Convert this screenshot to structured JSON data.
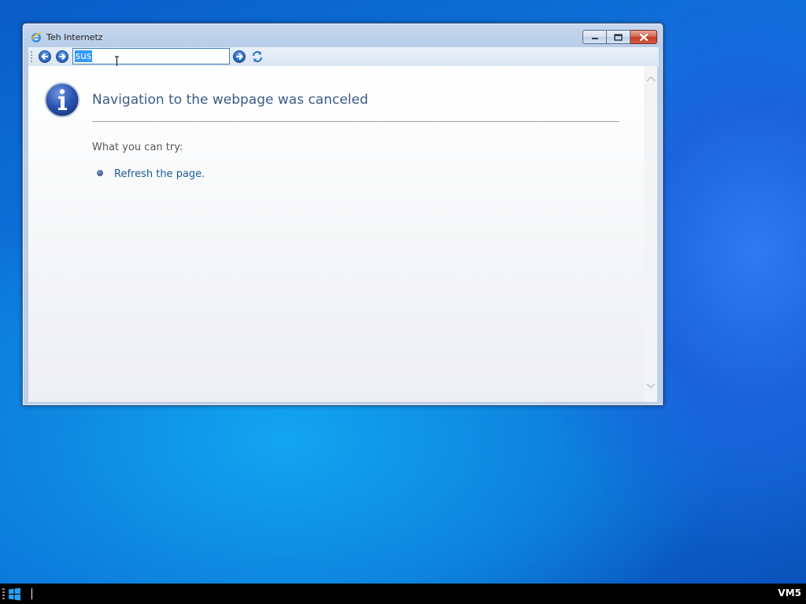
{
  "window": {
    "title": "Teh Internetz",
    "caption_buttons": {
      "minimize": "minimize",
      "maximize": "maximize",
      "close": "close"
    }
  },
  "toolbar": {
    "address_value": "sus",
    "back_icon": "back-arrow-icon",
    "forward_icon": "forward-arrow-icon",
    "go_icon": "go-arrow-icon",
    "refresh_icon": "refresh-icon"
  },
  "page": {
    "heading": "Navigation to the webpage was canceled",
    "try_label": "What you can try:",
    "suggestions": [
      {
        "label": "Refresh the page."
      }
    ]
  },
  "taskbar": {
    "label": "VM5"
  },
  "colors": {
    "heading": "#3b5d86",
    "link": "#1d5a92",
    "selection": "#3399ff"
  }
}
